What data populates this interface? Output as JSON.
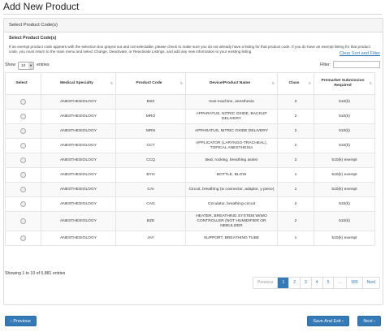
{
  "page_title": "Add New Product",
  "panel_heading": "Select Product Code(s)",
  "section_title": "Select Product Code(s)",
  "instructions": "If an exempt product code appears with the selection box grayed out and not selectable, please check to make sure you do not already have a listing for that product code. If you do have an exempt listing for that product code, you must return to the main menu and select Change, Deactivate, or Reactivate Listings, and add any new information to your existing listing.",
  "clear_sort_label": "Clear Sort and Filter",
  "show_label": "Show",
  "entries_label": "entries",
  "page_size": "10",
  "filter_label": "Filter:",
  "filter_value": "",
  "columns": [
    "Select",
    "Medical Specialty",
    "Product Code",
    "Device/Product Name",
    "Class",
    "Premarket Submission Required"
  ],
  "rows": [
    {
      "specialty": "ANESTHESIOLOGY",
      "code": "BSZ",
      "name": "Gas-machine, anesthesia",
      "class": "2",
      "submission": "510(k)"
    },
    {
      "specialty": "ANESTHESIOLOGY",
      "code": "MRO",
      "name": "APPARATUS, NITRIC OXIDE, BACKUP DELIVERY",
      "class": "2",
      "submission": "510(k)"
    },
    {
      "specialty": "ANESTHESIOLOGY",
      "code": "MRN",
      "name": "APPARATUS, NITRIC OXIDE DELIVERY",
      "class": "2",
      "submission": "510(k)"
    },
    {
      "specialty": "ANESTHESIOLOGY",
      "code": "CCT",
      "name": "APPLICATOR (LARYNGO-TRACHEAL), TOPICAL ANESTHESIA",
      "class": "2",
      "submission": "510(k)"
    },
    {
      "specialty": "ANESTHESIOLOGY",
      "code": "CCQ",
      "name": "Bed, rocking, breathing assist",
      "class": "2",
      "submission": "510(k) exempt"
    },
    {
      "specialty": "ANESTHESIOLOGY",
      "code": "BYO",
      "name": "BOTTLE, BLOW",
      "class": "1",
      "submission": "510(k) exempt"
    },
    {
      "specialty": "ANESTHESIOLOGY",
      "code": "CAI",
      "name": "Circuit, breathing (w connector, adaptor, y piece)",
      "class": "1",
      "submission": "510(k) exempt"
    },
    {
      "specialty": "ANESTHESIOLOGY",
      "code": "CAG",
      "name": "Circulator, breathing-circuit",
      "class": "2",
      "submission": "510(k)"
    },
    {
      "specialty": "ANESTHESIOLOGY",
      "code": "BZE",
      "name": "HEATER, BREATHING SYSTEM W/WO CONTROLLER (NOT HUMIDIFIER OR NEBULIZER",
      "class": "2",
      "submission": "510(k)"
    },
    {
      "specialty": "ANESTHESIOLOGY",
      "code": "JAY",
      "name": "SUPPORT, BREATHING TUBE",
      "class": "1",
      "submission": "510(k) exempt"
    }
  ],
  "showing_text": "Showing 1 to 10 of 5,881 entries",
  "pagination": {
    "previous": "Previous",
    "pages": [
      "1",
      "2",
      "3",
      "4",
      "5",
      "…",
      "589"
    ],
    "active": "1",
    "next": "Next"
  },
  "buttons": {
    "previous": "‹ Previous",
    "save_exit": "Save And Exit ›",
    "next": "Next ›"
  },
  "colors": {
    "primary": "#337ab7",
    "link": "#337ab7"
  }
}
